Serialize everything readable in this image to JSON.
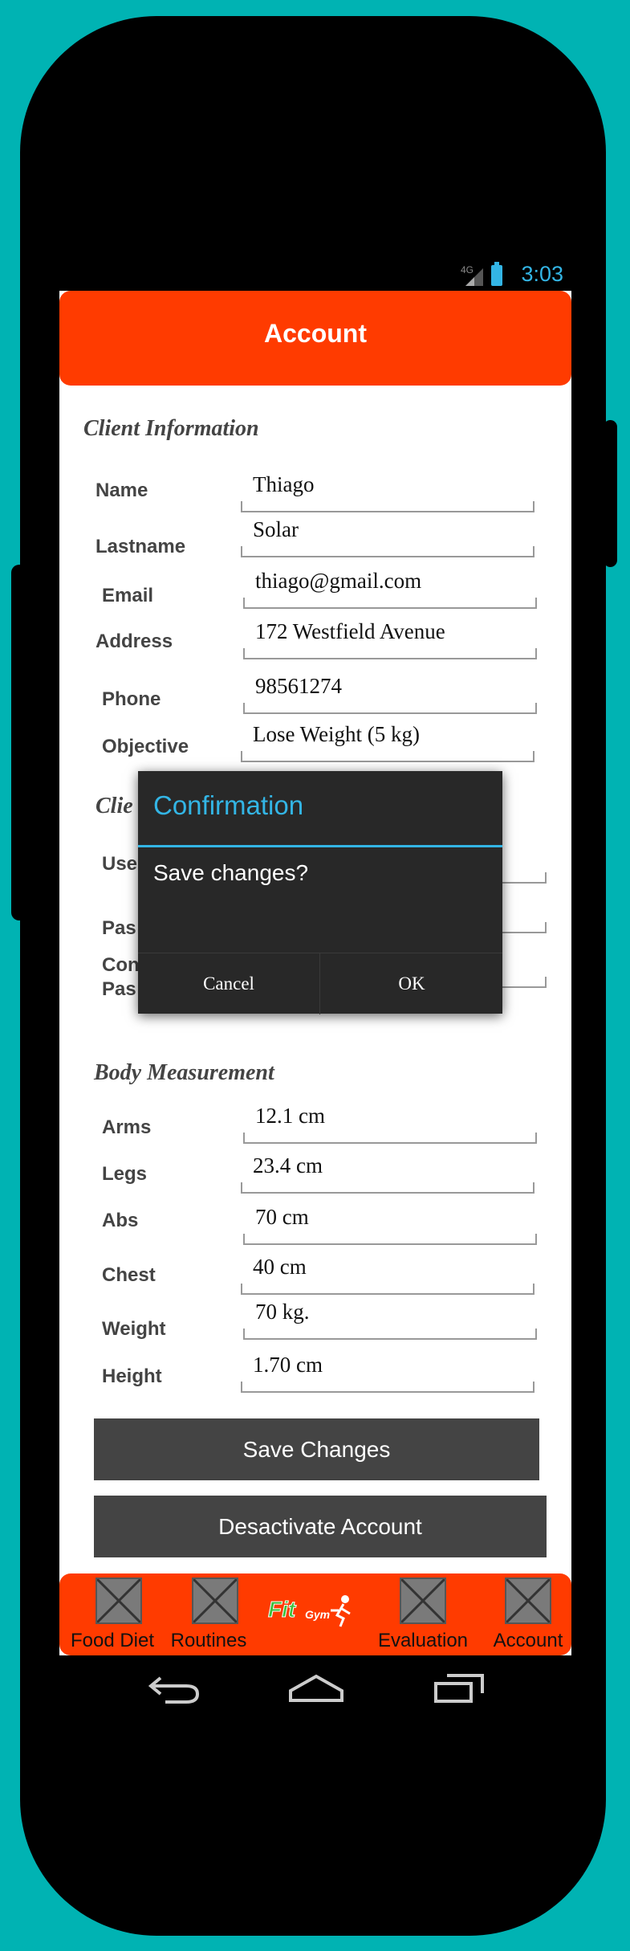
{
  "status_bar": {
    "network": "4G",
    "time": "3:03"
  },
  "app_bar": {
    "title": "Account"
  },
  "client_info": {
    "title": "Client Information",
    "fields": [
      {
        "label": "Name",
        "value": "Thiago"
      },
      {
        "label": "Lastname",
        "value": "Solar"
      },
      {
        "label": "Email",
        "value": "thiago@gmail.com"
      },
      {
        "label": "Address",
        "value": "172 Westfield Avenue"
      },
      {
        "label": "Phone",
        "value": "98561274"
      },
      {
        "label": "Objective",
        "value": "Lose Weight (5 kg)"
      }
    ]
  },
  "account_section": {
    "title_partial": "Clie",
    "label_user_partial": "Use",
    "label_pass_partial": "Pas",
    "label_confirm_partial_1": "Con",
    "label_confirm_partial_2": "Pas"
  },
  "dialog": {
    "title": "Confirmation",
    "message": "Save changes?",
    "cancel_label": "Cancel",
    "ok_label": "OK"
  },
  "body_measurement": {
    "title": "Body Measurement",
    "fields": [
      {
        "label": "Arms",
        "value": "12.1 cm"
      },
      {
        "label": "Legs",
        "value": "23.4 cm"
      },
      {
        "label": "Abs",
        "value": "70 cm"
      },
      {
        "label": "Chest",
        "value": "40 cm"
      },
      {
        "label": "Weight",
        "value": "70 kg."
      },
      {
        "label": "Height",
        "value": "1.70 cm"
      }
    ]
  },
  "buttons": {
    "save": "Save Changes",
    "deactivate": "Desactivate Account"
  },
  "bottom_nav": {
    "items": [
      {
        "label": "Food Diet",
        "icon": "broken-image-icon"
      },
      {
        "label": "Routines",
        "icon": "broken-image-icon"
      },
      {
        "label": "Evaluation",
        "icon": "broken-image-icon"
      },
      {
        "label": "Account",
        "icon": "broken-image-icon"
      }
    ],
    "logo_text_1": "Fit",
    "logo_text_2": "Gym"
  },
  "colors": {
    "accent": "#ff3b00",
    "dialog_accent": "#33b5e5",
    "background": "#00b3b3",
    "button": "#444444"
  }
}
